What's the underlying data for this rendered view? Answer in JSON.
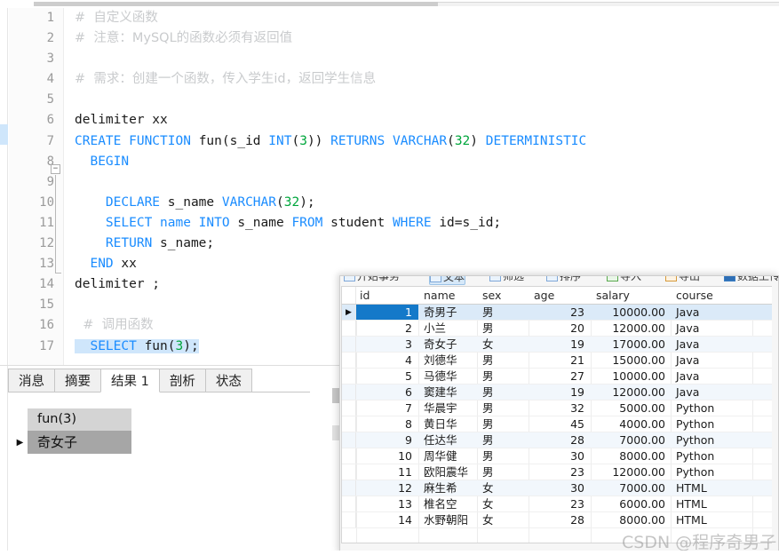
{
  "editor": {
    "line_numbers": [
      "1",
      "2",
      "3",
      "4",
      "5",
      "6",
      "7",
      "8",
      "9",
      "10",
      "11",
      "12",
      "13",
      "14",
      "15",
      "16",
      "17"
    ],
    "lines": [
      {
        "n": "1",
        "segments": [
          {
            "t": "#  自定义函数",
            "c": "cmt"
          }
        ]
      },
      {
        "n": "2",
        "segments": [
          {
            "t": "#  注意：MySQL的函数必须有返回值",
            "c": "cmt"
          }
        ]
      },
      {
        "n": "3",
        "segments": []
      },
      {
        "n": "4",
        "segments": [
          {
            "t": "#  需求：创建一个函数，传入学生id，返回学生信息",
            "c": "cmt"
          }
        ]
      },
      {
        "n": "5",
        "segments": []
      },
      {
        "n": "6",
        "segments": [
          {
            "t": "delimiter xx",
            "c": "plain"
          }
        ]
      },
      {
        "n": "7",
        "segments": [
          {
            "t": "CREATE FUNCTION ",
            "c": "kw"
          },
          {
            "t": "fun(s_id ",
            "c": "plain"
          },
          {
            "t": "INT",
            "c": "kw"
          },
          {
            "t": "(",
            "c": "plain"
          },
          {
            "t": "3",
            "c": "num"
          },
          {
            "t": ")) ",
            "c": "plain"
          },
          {
            "t": "RETURNS VARCHAR",
            "c": "kw"
          },
          {
            "t": "(",
            "c": "plain"
          },
          {
            "t": "32",
            "c": "num"
          },
          {
            "t": ") ",
            "c": "plain"
          },
          {
            "t": "DETERMINISTIC",
            "c": "kw"
          }
        ]
      },
      {
        "n": "8",
        "segments": [
          {
            "t": "  BEGIN",
            "c": "kw"
          }
        ]
      },
      {
        "n": "9",
        "segments": []
      },
      {
        "n": "10",
        "segments": [
          {
            "t": "    DECLARE ",
            "c": "kw"
          },
          {
            "t": "s_name ",
            "c": "plain"
          },
          {
            "t": "VARCHAR",
            "c": "kw"
          },
          {
            "t": "(",
            "c": "plain"
          },
          {
            "t": "32",
            "c": "num"
          },
          {
            "t": ");",
            "c": "plain"
          }
        ]
      },
      {
        "n": "11",
        "segments": [
          {
            "t": "    SELECT name INTO ",
            "c": "kw"
          },
          {
            "t": "s_name ",
            "c": "plain"
          },
          {
            "t": "FROM ",
            "c": "kw"
          },
          {
            "t": "student ",
            "c": "plain"
          },
          {
            "t": "WHERE ",
            "c": "kw"
          },
          {
            "t": "id=s_id;",
            "c": "plain"
          }
        ]
      },
      {
        "n": "12",
        "segments": [
          {
            "t": "    RETURN ",
            "c": "kw"
          },
          {
            "t": "s_name;",
            "c": "plain"
          }
        ]
      },
      {
        "n": "13",
        "segments": [
          {
            "t": "  END ",
            "c": "kw"
          },
          {
            "t": "xx",
            "c": "plain"
          }
        ]
      },
      {
        "n": "14",
        "segments": [
          {
            "t": "delimiter ;",
            "c": "plain"
          }
        ]
      },
      {
        "n": "15",
        "segments": []
      },
      {
        "n": "16",
        "segments": [
          {
            "t": "  #  调用函数",
            "c": "cmt"
          }
        ]
      },
      {
        "n": "17",
        "segments": [
          {
            "t": "  SELECT ",
            "c": "kw hl-sel"
          },
          {
            "t": "fun(",
            "c": "plain hl-sel"
          },
          {
            "t": "3",
            "c": "num hl-sel"
          },
          {
            "t": ");",
            "c": "plain hl-sel"
          }
        ]
      }
    ],
    "colors": {
      "keyword": "#1a8cff",
      "number": "#00a63c",
      "comment": "#c9cbcd",
      "selection": "#cfe6fb"
    }
  },
  "results_panel": {
    "tabs": [
      {
        "label": "消息",
        "active": false
      },
      {
        "label": "摘要",
        "active": false
      },
      {
        "label": "结果 1",
        "active": true
      },
      {
        "label": "剖析",
        "active": false
      },
      {
        "label": "状态",
        "active": false
      }
    ],
    "grid": {
      "header": "fun(3)",
      "row_marker": "▶",
      "value": "奇女子"
    }
  },
  "data_grid_window": {
    "toolbar": [
      {
        "label": "开始事务",
        "icon": "transaction-icon",
        "selected": false
      },
      {
        "label": "文本",
        "icon": "text-icon",
        "selected": true
      },
      {
        "label": "筛选",
        "icon": "filter-icon",
        "selected": false
      },
      {
        "label": "排序",
        "icon": "sort-icon",
        "selected": false
      },
      {
        "label": "导入",
        "icon": "import-icon",
        "selected": false
      },
      {
        "label": "导出",
        "icon": "export-icon",
        "selected": false
      },
      {
        "label": "数据上传",
        "icon": "upload-icon",
        "selected": false
      }
    ],
    "columns": [
      "id",
      "name",
      "sex",
      "age",
      "salary",
      "course"
    ],
    "rows": [
      {
        "mark": "▶",
        "id": "1",
        "name": "奇男子",
        "sex": "男",
        "age": "23",
        "salary": "10000.00",
        "course": "Java",
        "selected": true
      },
      {
        "mark": "",
        "id": "2",
        "name": "小兰",
        "sex": "男",
        "age": "20",
        "salary": "12000.00",
        "course": "Java",
        "selected": false
      },
      {
        "mark": "",
        "id": "3",
        "name": "奇女子",
        "sex": "女",
        "age": "19",
        "salary": "17000.00",
        "course": "Java",
        "selected": false
      },
      {
        "mark": "",
        "id": "4",
        "name": "刘德华",
        "sex": "男",
        "age": "21",
        "salary": "15000.00",
        "course": "Java",
        "selected": false
      },
      {
        "mark": "",
        "id": "5",
        "name": "马德华",
        "sex": "男",
        "age": "27",
        "salary": "10000.00",
        "course": "Java",
        "selected": false
      },
      {
        "mark": "",
        "id": "6",
        "name": "窦建华",
        "sex": "男",
        "age": "19",
        "salary": "12000.00",
        "course": "Java",
        "selected": false
      },
      {
        "mark": "",
        "id": "7",
        "name": "华晨宇",
        "sex": "男",
        "age": "32",
        "salary": "5000.00",
        "course": "Python",
        "selected": false
      },
      {
        "mark": "",
        "id": "8",
        "name": "黄日华",
        "sex": "男",
        "age": "45",
        "salary": "4000.00",
        "course": "Python",
        "selected": false
      },
      {
        "mark": "",
        "id": "9",
        "name": "任达华",
        "sex": "男",
        "age": "28",
        "salary": "7000.00",
        "course": "Python",
        "selected": false
      },
      {
        "mark": "",
        "id": "10",
        "name": "周华健",
        "sex": "男",
        "age": "30",
        "salary": "8000.00",
        "course": "Python",
        "selected": false
      },
      {
        "mark": "",
        "id": "11",
        "name": "欧阳震华",
        "sex": "男",
        "age": "23",
        "salary": "12000.00",
        "course": "Python",
        "selected": false
      },
      {
        "mark": "",
        "id": "12",
        "name": "麻生希",
        "sex": "女",
        "age": "30",
        "salary": "7000.00",
        "course": "HTML",
        "selected": false
      },
      {
        "mark": "",
        "id": "13",
        "name": "椎名空",
        "sex": "女",
        "age": "23",
        "salary": "6000.00",
        "course": "HTML",
        "selected": false
      },
      {
        "mark": "",
        "id": "14",
        "name": "水野朝阳",
        "sex": "女",
        "age": "28",
        "salary": "8000.00",
        "course": "HTML",
        "selected": false
      }
    ],
    "selection_color": "#1479c9"
  },
  "watermark": {
    "text": "CSDN @程序奇男子"
  }
}
